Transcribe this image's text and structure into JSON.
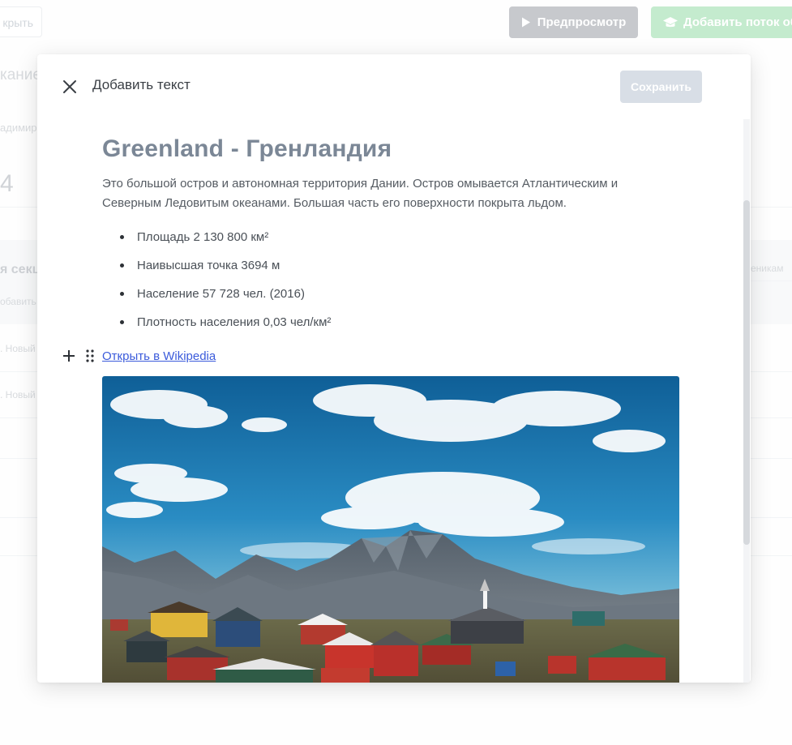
{
  "background": {
    "open_button_label": "крыть",
    "preview_button_label": "Предпросмотр",
    "add_stream_button_label": "Добавить поток об",
    "description_fragment": "кание",
    "author_fragment": "адимир",
    "number_fragment": "4",
    "section_fragment": "я секц",
    "add_fragment": "обавить",
    "row1_fragment": ". Новый",
    "row2_fragment": ". Новый",
    "students_fragment": "еникам"
  },
  "modal": {
    "title": "Добавить текст",
    "save_label": "Сохранить",
    "close_icon": "close-icon"
  },
  "document": {
    "title": "Greenland - Гренландия",
    "paragraph": "Это большой остров и автономная территория Дании. Остров омывается Атлантическим и Северным Ледовитым океанами. Большая часть его поверхности покрыта льдом.",
    "facts": [
      "Площадь 2 130 800 км²",
      "Наивысшая точка 3694 м",
      "Население 57 728 чел. (2016)",
      "Плотность населения 0,03 чел/км²"
    ],
    "link_text": "Открыть в Wikipedia"
  },
  "colors": {
    "preview_button": "#a9adb3",
    "stream_button": "#a5e0b4",
    "save_button": "#d8dee6",
    "title": "#7b8796",
    "link": "#3b5bdb"
  }
}
